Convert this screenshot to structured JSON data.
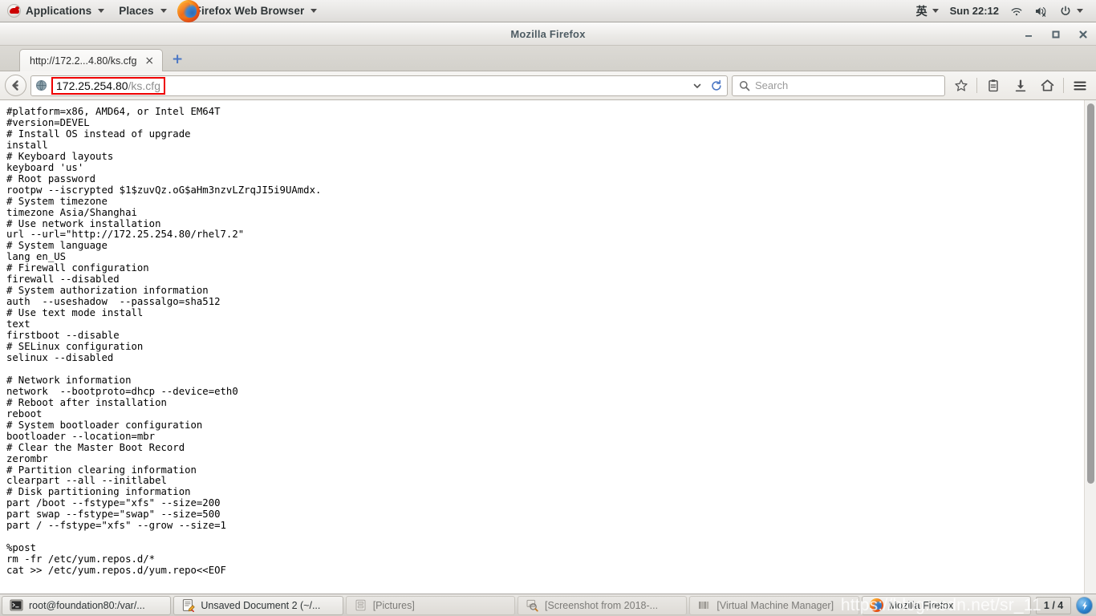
{
  "top_panel": {
    "applications_label": "Applications",
    "places_label": "Places",
    "active_app_label": "Firefox Web Browser",
    "ime_label": "英",
    "clock": "Sun 22:12",
    "icons": {
      "redhat": "redhat-logo-icon",
      "firefox": "firefox-logo-icon",
      "wifi": "wifi-icon",
      "volume": "volume-muted-icon",
      "power": "power-icon",
      "caret": "chevron-down-icon"
    }
  },
  "window": {
    "title": "Mozilla Firefox",
    "controls": {
      "minimize": "minimize-button",
      "maximize": "maximize-button",
      "close": "close-button"
    }
  },
  "tabs": [
    {
      "label": "http://172.2...4.80/ks.cfg",
      "close": "×"
    }
  ],
  "new_tab_label": "+",
  "navbar": {
    "back_icon": "back-arrow-icon",
    "identity_icon": "globe-icon",
    "url_host": "172.25.254.80",
    "url_path": "/ks.cfg",
    "dropdown_icon": "chevron-down-icon",
    "reload_icon": "reload-icon",
    "search_placeholder": "Search",
    "search_value": "",
    "search_icon": "search-icon",
    "bookmark_icon": "star-icon",
    "reader_icon": "reading-list-icon",
    "download_icon": "download-arrow-icon",
    "home_icon": "home-icon",
    "menu_icon": "hamburger-menu-icon",
    "highlight_color": "#ee0000"
  },
  "page": {
    "body_text": "#platform=x86, AMD64, or Intel EM64T\n#version=DEVEL\n# Install OS instead of upgrade\ninstall\n# Keyboard layouts\nkeyboard 'us'\n# Root password\nrootpw --iscrypted $1$zuvQz.oG$aHm3nzvLZrqJI5i9UAmdx.\n# System timezone\ntimezone Asia/Shanghai\n# Use network installation\nurl --url=\"http://172.25.254.80/rhel7.2\"\n# System language\nlang en_US\n# Firewall configuration\nfirewall --disabled\n# System authorization information\nauth  --useshadow  --passalgo=sha512\n# Use text mode install\ntext\nfirstboot --disable\n# SELinux configuration\nselinux --disabled\n\n# Network information\nnetwork  --bootproto=dhcp --device=eth0\n# Reboot after installation\nreboot\n# System bootloader configuration\nbootloader --location=mbr\n# Clear the Master Boot Record\nzerombr\n# Partition clearing information\nclearpart --all --initlabel\n# Disk partitioning information\npart /boot --fstype=\"xfs\" --size=200\npart swap --fstype=\"swap\" --size=500\npart / --fstype=\"xfs\" --grow --size=1\n\n%post\nrm -fr /etc/yum.repos.d/*\ncat >> /etc/yum.repos.d/yum.repo<<EOF"
  },
  "taskbar": {
    "items": [
      {
        "label": "root@foundation80:/var/...",
        "icon": "terminal-icon",
        "active": true
      },
      {
        "label": "Unsaved Document 2 (~/...",
        "icon": "text-editor-icon",
        "active": true
      },
      {
        "label": "[Pictures]",
        "icon": "file-manager-icon",
        "active": false
      },
      {
        "label": "[Screenshot from 2018-...",
        "icon": "image-viewer-icon",
        "active": false
      },
      {
        "label": "[Virtual Machine Manager]",
        "icon": "vmm-icon",
        "active": false
      },
      {
        "label": "Mozilla Firefox",
        "icon": "firefox-logo-icon",
        "active": true
      }
    ],
    "workspace_label": "1 / 4",
    "show_desktop_icon": "show-desktop-icon",
    "watermark": "https://blog.csdn.net/sr_11"
  }
}
